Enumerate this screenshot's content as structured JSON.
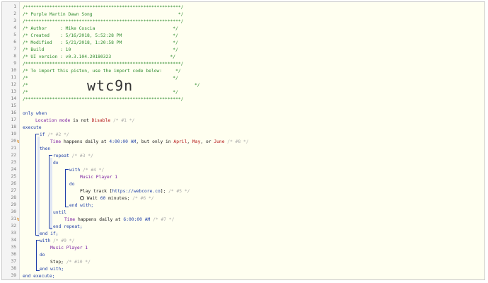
{
  "line_numbers": [
    "1",
    "2",
    "3",
    "4",
    "5",
    "6",
    "7",
    "8",
    "9",
    "10",
    "11",
    "12",
    "13",
    "14",
    "15",
    "16",
    "17",
    "18",
    "19",
    "20",
    "21",
    "22",
    "23",
    "24",
    "25",
    "26",
    "27",
    "28",
    "29",
    "30",
    "31",
    "32",
    "33",
    "34",
    "35",
    "36",
    "37",
    "38",
    "39"
  ],
  "header": {
    "border_line": "/**********************************************************/",
    "title": "/* Purple Martin Dawn Song                                */",
    "author": "/* Author     : Mike Coscia                             */",
    "created": "/* Created    : 5/16/2018, 5:52:28 PM                   */",
    "modified": "/* Modified   : 5/21/2018, 1:20:58 PM                   */",
    "build": "/* Build      : 10                                      */",
    "ui_version": "/* UI version : v0.3.104.20180323                      */",
    "import_note": "/* To import this piston, use the import code below:     */",
    "blank1": "/*                                                      */",
    "code_prefix": "/*",
    "code_suffix": "*/",
    "import_code": "wtc9n",
    "blank2": "/*                                                      */"
  },
  "code": {
    "only_when": "only when",
    "cond1_subject": "Location mode",
    "cond1_op": " is not ",
    "cond1_value": "Disable",
    "cond1_comment": " /* #1 */",
    "execute": "execute",
    "if_kw": "if",
    "if_comment": " /* #2 */",
    "time_kw": "Time",
    "happens_daily": " happens daily at ",
    "time1": "4:00:00 AM",
    "only_in": ", but only in ",
    "month1": "April",
    "comma1": ", ",
    "month2": "May",
    "or": ", or ",
    "month3": "June",
    "trig1_comment": " /* #8 */",
    "then": "then",
    "repeat": "repeat",
    "repeat_comment": " /* #3 */",
    "do1": "do",
    "with1": "with",
    "with1_comment": " /* #4 */",
    "device1": "Music Player 1",
    "do2": "do",
    "play_track": "Play track [",
    "track_url": "https://webcore.co",
    "play_end": "];",
    "play_comment": " /* #5 */",
    "wait_label": " Wait ",
    "wait_value": "60",
    "wait_unit": " minutes;",
    "wait_comment": " /* #6 */",
    "end_with1": "end with;",
    "until": "until",
    "time_kw2": "Time",
    "happens_daily2": " happens daily at ",
    "time2": "6:00:00 AM",
    "trig2_comment": " /* #7 */",
    "end_repeat": "end repeat;",
    "end_if": "end if;",
    "with2": "with",
    "with2_comment": " /* #9 */",
    "device2": "Music Player 1",
    "do3": "do",
    "stop": "Stop;",
    "stop_comment": " /* #10 */",
    "end_with2": "end with;",
    "end_execute": "end execute;"
  },
  "colors": {
    "comment": "#2d8a2d",
    "keyword": "#1f3fa8",
    "device": "#7b1fa2",
    "value": "#b31313",
    "background": "#fffff0"
  },
  "icons": {
    "trigger_flag": "lightning-flag-icon",
    "wait": "clock-icon"
  }
}
